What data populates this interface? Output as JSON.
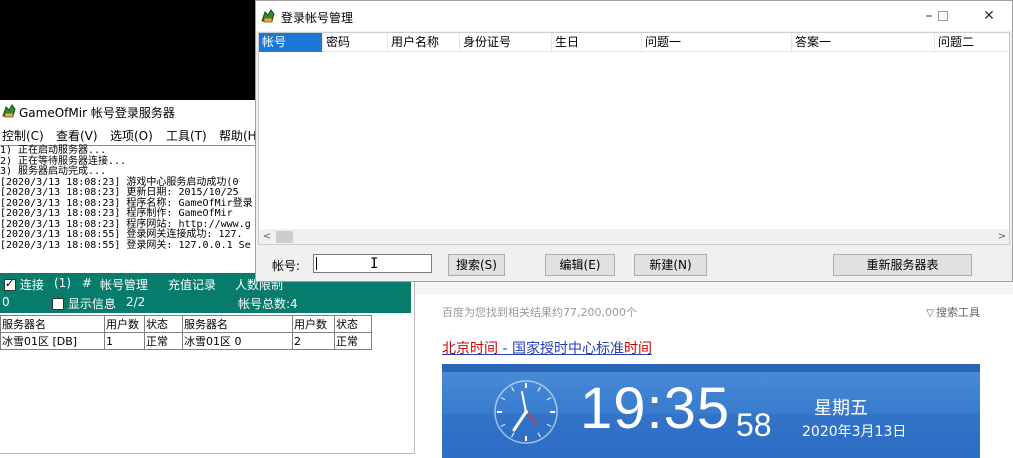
{
  "browser": {
    "results_text": "百度为您找到相关结果约77,200,000个",
    "tools_label": "搜索工具",
    "link_red_1": "北京时间",
    "link_middle": " - 国家授时中心标准",
    "link_red_2": "时间",
    "clock": {
      "time": "19:35",
      "seconds": "58",
      "weekday": "星期五",
      "date": "2020年3月13日"
    }
  },
  "gom": {
    "title": "GameOfMir 帐号登录服务器",
    "menu": [
      "控制(C)",
      "查看(V)",
      "选项(O)",
      "工具(T)",
      "帮助(H"
    ],
    "log_lines": [
      "1) 正在启动服务器...",
      "2) 正在等待服务器连接...",
      "3) 服务器启动完成...",
      "[2020/3/13 18:08:23] 游戏中心服务启动成功(0",
      "[2020/3/13 18:08:23] 更新日期: 2015/10/25",
      "[2020/3/13 18:08:23] 程序名称: GameOfMir登录",
      "[2020/3/13 18:08:23] 程序制作: GameOfMir",
      "[2020/3/13 18:08:23] 程序网站: http://www.g",
      "[2020/3/13 18:08:55] 登录网关连接成功: 127.",
      "[2020/3/13 18:08:55] 登录网关: 127.0.0.1 Se"
    ],
    "status": {
      "connect_label": "连接",
      "connect_count": "(1)",
      "hash": "#",
      "account_mgmt": "帐号管理",
      "recharge": "充值记录",
      "people_limit": "人数限制",
      "zero": "0",
      "show_info": "显示信息",
      "show_info_count": "2/2",
      "account_total": "帐号总数:4"
    },
    "grid_headers": [
      "服务器名",
      "用户数",
      "状态",
      "服务器名",
      "用户数",
      "状态"
    ],
    "grid_rows": [
      [
        "冰雪01区 [DB]",
        "1",
        "正常",
        "冰雪01区 0",
        "2",
        "正常"
      ]
    ]
  },
  "dialog": {
    "title": "登录帐号管理",
    "columns": [
      "帐号",
      "密码",
      "用户名称",
      "身份证号",
      "生日",
      "问题一",
      "答案一",
      "问题二"
    ],
    "account_label": "帐号:",
    "account_value": "",
    "search_btn": "搜索(S)",
    "edit_btn": "编辑(E)",
    "new_btn": "新建(N)",
    "refresh_btn": "重新服务器表"
  },
  "icons": {
    "app": "green-dragon-app-icon",
    "minimize": "minimize-icon",
    "maximize": "maximize-icon",
    "close": "close-icon"
  }
}
